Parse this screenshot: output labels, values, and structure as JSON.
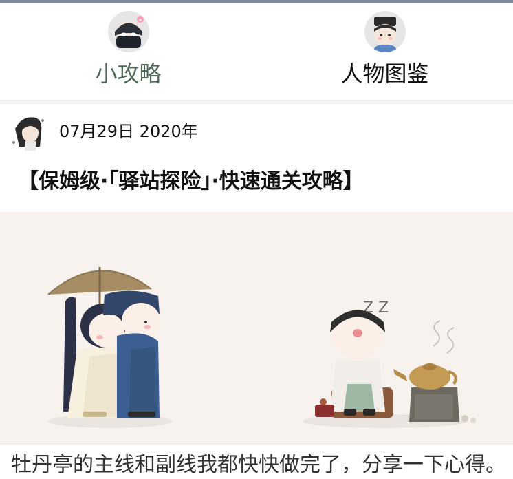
{
  "tabs": [
    {
      "label": "小攻略",
      "active": true,
      "icon": "masked-character-avatar"
    },
    {
      "label": "人物图鉴",
      "active": false,
      "icon": "scholar-character-avatar"
    }
  ],
  "post": {
    "date": "07月29日 2020年",
    "title": "【保姆级·「驿站探险」·快速通关攻略】",
    "body_preview": "牡丹亭的主线和副线我都快快做完了，分享一下心得。"
  },
  "banner": {
    "sleep_text": "Z Z"
  },
  "colors": {
    "active_tab": "#4f6a56",
    "indicator": "#6d8370",
    "banner_bg": "#f7f2ee"
  }
}
